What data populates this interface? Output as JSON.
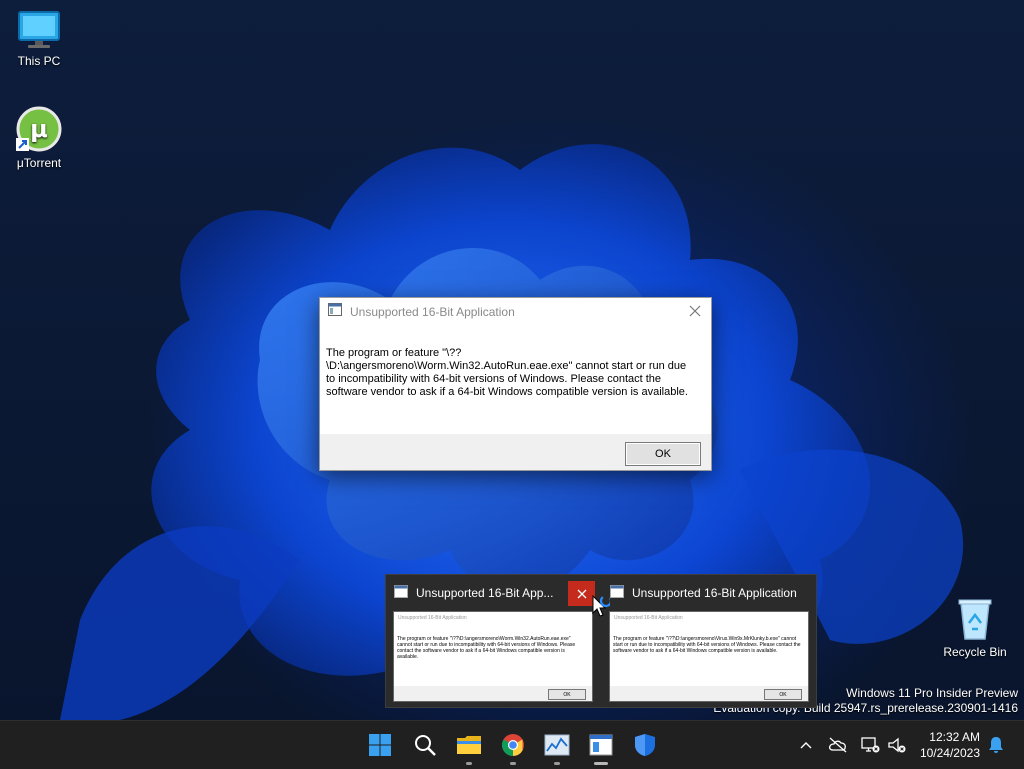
{
  "desktop": {
    "icons": [
      {
        "label": "This PC",
        "icon": "monitor-icon"
      },
      {
        "label": "μTorrent",
        "icon": "utorrent-icon"
      },
      {
        "label": "Recycle Bin",
        "icon": "recycle-bin-icon"
      }
    ],
    "watermark": {
      "line1": "Windows 11 Pro Insider Preview",
      "line2": "Evaluation copy. Build 25947.rs_prerelease.230901-1416"
    }
  },
  "dialog": {
    "title": "Unsupported 16-Bit Application",
    "message": "The program or feature \"\\??\\D:\\angersmoreno\\Worm.Win32.AutoRun.eae.exe\" cannot start or run due to incompatibility with 64-bit versions of Windows. Please contact the software vendor to ask if a 64-bit Windows compatible version is available.",
    "ok_label": "OK"
  },
  "thumbnails": [
    {
      "title": "Unsupported 16-Bit App...",
      "mini_title": "Unsupported 16-Bit Application",
      "mini_text": "The program or feature \"\\??\\D:\\angersmoreno\\Worm.Win32.AutoRun.eae.exe\" cannot start or run due to incompatibility with 64-bit versions of Windows. Please contact the software vendor to ask if a 64-bit Windows compatible version is available.",
      "ok_label": "OK"
    },
    {
      "title": "Unsupported 16-Bit Application",
      "mini_title": "Unsupported 16-Bit Application",
      "mini_text": "The program or feature \"\\??\\D:\\angersmoreno\\Virus.Win9x.MrKlunky.b.exe\" cannot start or run due to incompatibility with 64-bit versions of Windows. Please contact the software vendor to ask if a 64-bit Windows compatible version is available.",
      "ok_label": "OK"
    }
  ],
  "taskbar": {
    "apps": [
      "start-icon",
      "search-icon",
      "file-explorer-icon",
      "chrome-icon",
      "task-manager-icon",
      "dialog-window-icon",
      "security-shield-icon"
    ],
    "clock": {
      "time": "12:32 AM",
      "date": "10/24/2023"
    }
  },
  "colors": {
    "accent": "#0078d4",
    "close_red": "#c42b1c",
    "taskbar": "#202020"
  }
}
